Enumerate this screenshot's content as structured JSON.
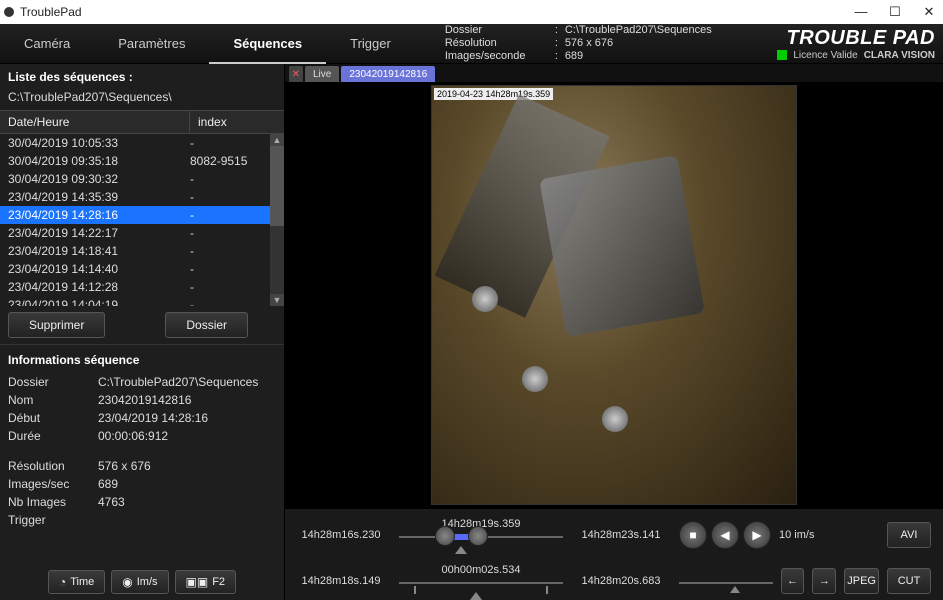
{
  "window": {
    "title": "TroublePad"
  },
  "brand": {
    "title": "TROUBLE PAD",
    "licence": "Licence Valide",
    "vendor": "CLARA VISION"
  },
  "nav": {
    "tabs": [
      "Caméra",
      "Paramètres",
      "Séquences",
      "Trigger"
    ],
    "active": 2
  },
  "header_info": {
    "dossier_label": "Dossier",
    "dossier_value": "C:\\TroublePad207\\Sequences",
    "resolution_label": "Résolution",
    "resolution_value": "576 x 676",
    "fps_label": "Images/seconde",
    "fps_value": "689"
  },
  "seqlist": {
    "title": "Liste des séquences :",
    "path": "C:\\TroublePad207\\Sequences\\",
    "col_date": "Date/Heure",
    "col_index": "index",
    "rows": [
      {
        "dt": "30/04/2019 10:05:33",
        "idx": "-"
      },
      {
        "dt": "30/04/2019 09:35:18",
        "idx": "8082-9515"
      },
      {
        "dt": "30/04/2019 09:30:32",
        "idx": "-"
      },
      {
        "dt": "23/04/2019 14:35:39",
        "idx": "-"
      },
      {
        "dt": "23/04/2019 14:28:16",
        "idx": "-"
      },
      {
        "dt": "23/04/2019 14:22:17",
        "idx": "-"
      },
      {
        "dt": "23/04/2019 14:18:41",
        "idx": "-"
      },
      {
        "dt": "23/04/2019 14:14:40",
        "idx": "-"
      },
      {
        "dt": "23/04/2019 14:12:28",
        "idx": "-"
      },
      {
        "dt": "23/04/2019 14:04:19",
        "idx": "-"
      }
    ],
    "selected": 4,
    "btn_delete": "Supprimer",
    "btn_folder": "Dossier"
  },
  "info": {
    "title": "Informations séquence",
    "dossier_l": "Dossier",
    "dossier_v": "C:\\TroublePad207\\Sequences",
    "nom_l": "Nom",
    "nom_v": "23042019142816",
    "debut_l": "Début",
    "debut_v": "23/04/2019 14:28:16",
    "duree_l": "Durée",
    "duree_v": "00:00:06:912",
    "res_l": "Résolution",
    "res_v": "576 x 676",
    "fps_l": "Images/sec",
    "fps_v": "689",
    "nimg_l": "Nb Images",
    "nimg_v": "4763",
    "trig_l": "Trigger",
    "trig_v": ""
  },
  "bottombar": {
    "time": "Time",
    "ims": "Im/s",
    "f2": "F2"
  },
  "viewer": {
    "tab_live": "Live",
    "tab_seq": "23042019142816",
    "overlay": "2019-04-23 14h28m19s.359"
  },
  "timeline": {
    "top": {
      "start": "14h28m16s.230",
      "caption": "14h28m19s.359",
      "end": "14h28m23s.141"
    },
    "bot": {
      "start": "14h28m18s.149",
      "caption": "00h00m02s.534",
      "end": "14h28m20s.683"
    },
    "rate": "10 im/s",
    "btn_avi": "AVI",
    "btn_jpeg": "JPEG",
    "btn_cut": "CUT"
  }
}
